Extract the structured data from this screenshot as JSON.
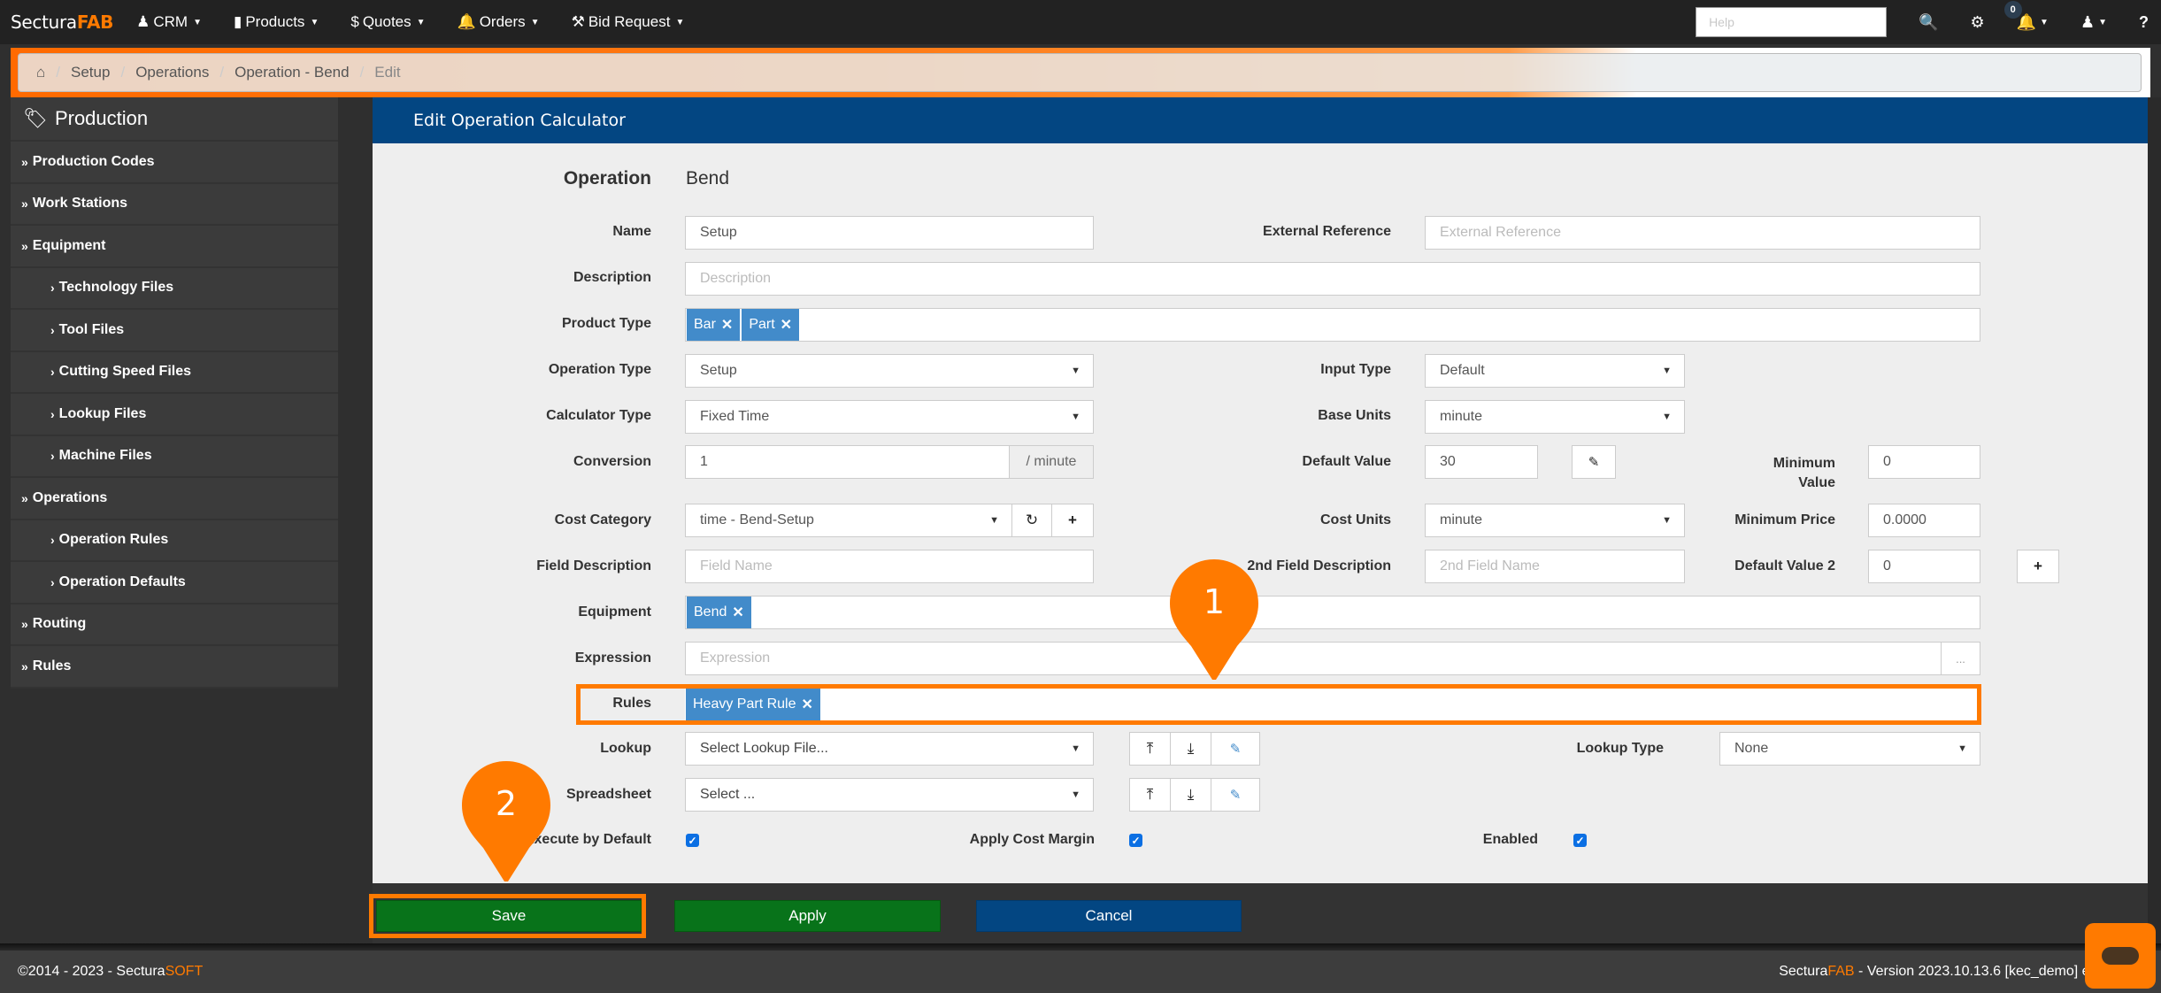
{
  "navbar": {
    "brand_main": "Sectura",
    "brand_accent": "FAB",
    "items": [
      {
        "label": "CRM",
        "icon": "user-icon"
      },
      {
        "label": "Products",
        "icon": "barcode-icon"
      },
      {
        "label": "Quotes",
        "icon": "dollar-icon"
      },
      {
        "label": "Orders",
        "icon": "bell-icon"
      },
      {
        "label": "Bid Request",
        "icon": "gavel-icon"
      }
    ],
    "help_placeholder": "Help",
    "notification_count": "0"
  },
  "breadcrumb": {
    "items": [
      "Setup",
      "Operations",
      "Operation - Bend"
    ],
    "current": "Edit"
  },
  "sidebar": {
    "title": "Production",
    "items": [
      {
        "label": "Production Codes",
        "level": 1
      },
      {
        "label": "Work Stations",
        "level": 1
      },
      {
        "label": "Equipment",
        "level": 1
      },
      {
        "label": "Technology Files",
        "level": 2
      },
      {
        "label": "Tool Files",
        "level": 2
      },
      {
        "label": "Cutting Speed Files",
        "level": 2
      },
      {
        "label": "Lookup Files",
        "level": 2
      },
      {
        "label": "Machine Files",
        "level": 2
      },
      {
        "label": "Operations",
        "level": 1
      },
      {
        "label": "Operation Rules",
        "level": 2
      },
      {
        "label": "Operation Defaults",
        "level": 2
      },
      {
        "label": "Routing",
        "level": 1
      },
      {
        "label": "Rules",
        "level": 1
      }
    ]
  },
  "panel": {
    "title": "Edit Operation Calculator"
  },
  "form": {
    "operation_label": "Operation",
    "operation_value": "Bend",
    "name_label": "Name",
    "name_value": "Setup",
    "external_reference_label": "External Reference",
    "external_reference_placeholder": "External Reference",
    "description_label": "Description",
    "description_placeholder": "Description",
    "product_type_label": "Product Type",
    "product_type_tags": [
      "Bar",
      "Part"
    ],
    "operation_type_label": "Operation Type",
    "operation_type_value": "Setup",
    "input_type_label": "Input Type",
    "input_type_value": "Default",
    "calculator_type_label": "Calculator Type",
    "calculator_type_value": "Fixed Time",
    "base_units_label": "Base Units",
    "base_units_value": "minute",
    "conversion_label": "Conversion",
    "conversion_value": "1",
    "conversion_suffix": "/ minute",
    "default_value_label": "Default Value",
    "default_value_value": "30",
    "minimum_value_label_1": "Minimum",
    "minimum_value_label_2": "Value",
    "minimum_value_value": "0",
    "cost_category_label": "Cost Category",
    "cost_category_value": "time - Bend-Setup",
    "cost_units_label": "Cost Units",
    "cost_units_value": "minute",
    "minimum_price_label": "Minimum Price",
    "minimum_price_value": "0.0000",
    "field_description_label": "Field Description",
    "field_description_placeholder": "Field Name",
    "second_field_description_label": "2nd Field Description",
    "second_field_description_placeholder": "2nd Field Name",
    "default_value_2_label": "Default Value 2",
    "default_value_2_value": "0",
    "equipment_label": "Equipment",
    "equipment_tags": [
      "Bend"
    ],
    "expression_label": "Expression",
    "expression_placeholder": "Expression",
    "expression_button": "...",
    "rules_label": "Rules",
    "rules_tags": [
      "Heavy Part Rule"
    ],
    "lookup_label": "Lookup",
    "lookup_value": "Select Lookup File...",
    "lookup_type_label": "Lookup Type",
    "lookup_type_value": "None",
    "spreadsheet_label": "Spreadsheet",
    "spreadsheet_value": "Select ...",
    "execute_by_default_label": "Execute by Default",
    "execute_by_default_checked": true,
    "apply_cost_margin_label": "Apply Cost Margin",
    "apply_cost_margin_checked": true,
    "enabled_label": "Enabled",
    "enabled_checked": true
  },
  "actions": {
    "save": "Save",
    "apply": "Apply",
    "cancel": "Cancel"
  },
  "callouts": [
    "1",
    "2"
  ],
  "footer": {
    "copyright_prefix": "©2014 - 2023 - Sectura",
    "copyright_accent": "SOFT",
    "version_brand": "Sectura",
    "version_brand_accent": "FAB",
    "version_text": " - Version 2023.10.13.6 [kec_demo] en-US"
  },
  "colors": {
    "accent": "#ff7a00",
    "header_blue": "#034682",
    "tag_blue": "#428bca",
    "save_green": "#08731a"
  }
}
